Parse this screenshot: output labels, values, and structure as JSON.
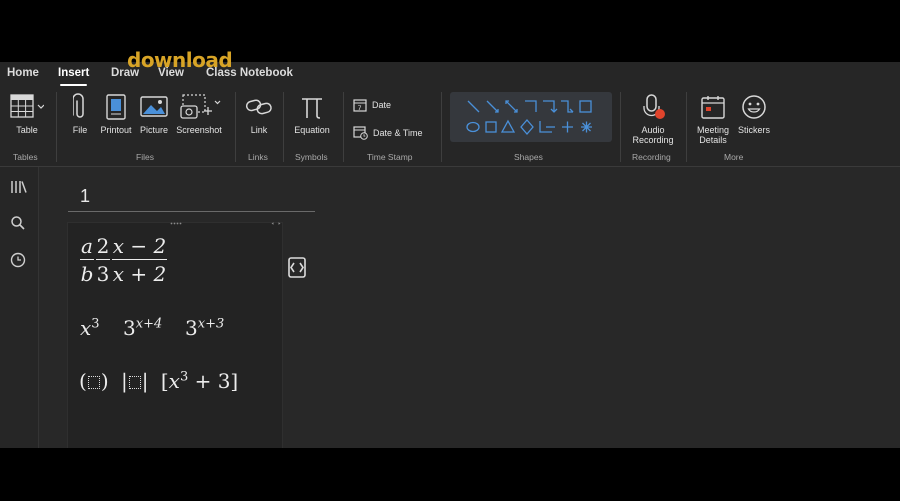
{
  "watermark": "download",
  "menu": {
    "tabs": [
      "Home",
      "Insert",
      "Draw",
      "View",
      "Class Notebook"
    ],
    "active": "Insert"
  },
  "ribbon": {
    "table": "Table",
    "file": "File",
    "printout": "Printout",
    "picture": "Picture",
    "screenshot": "Screenshot",
    "link": "Link",
    "equation": "Equation",
    "date": "Date",
    "date_time": "Date & Time",
    "audio_1": "Audio",
    "audio_2": "Recording",
    "meeting_1": "Meeting",
    "meeting_2": "Details",
    "stickers": "Stickers",
    "groups": {
      "tables": "Tables",
      "files": "Files",
      "links": "Links",
      "symbols": "Symbols",
      "timestamp": "Time Stamp",
      "shapes": "Shapes",
      "recording": "Recording",
      "more": "More"
    },
    "shape_color": "#4a90d9"
  },
  "page": {
    "title": "1",
    "math": {
      "frac_a": "a",
      "frac_b": "b",
      "frac_2": "2",
      "frac_3": "3",
      "frac_num": "x − 2",
      "frac_den": "x + 2",
      "x": "x",
      "exp3": "3",
      "base3": "3",
      "exp_x4": "x+4",
      "exp_x3": "x+3",
      "paren_open": "(",
      "paren_close": ")",
      "bar": "|",
      "bracket_open": "[",
      "plus3": " + 3]"
    }
  },
  "colors": {
    "background": "#262626",
    "accent": "#4a90d9",
    "record": "#e0442c"
  }
}
